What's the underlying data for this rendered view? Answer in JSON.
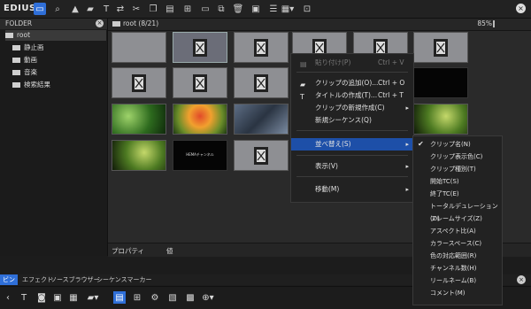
{
  "app": {
    "brand": "EDIUS"
  },
  "folder": {
    "header": "FOLDER",
    "items": [
      {
        "label": "root",
        "selected": true
      },
      {
        "label": "静止画"
      },
      {
        "label": "動画"
      },
      {
        "label": "音楽"
      },
      {
        "label": "検索結果"
      }
    ]
  },
  "bin": {
    "path": "root (8/21)",
    "zoom": "85%"
  },
  "properties": {
    "col1": "プロパティ",
    "col2": "値"
  },
  "clips": {
    "thumb_text": "HEMAチャンネル"
  },
  "tabs": {
    "items": [
      "ビン",
      "エフェクト",
      "ソースブラウザー",
      "シーケンスマーカー"
    ]
  },
  "context_menu": {
    "paste": {
      "label": "貼り付け(P)",
      "shortcut": "Ctrl + V"
    },
    "add_clip": {
      "label": "クリップの追加(O)...",
      "shortcut": "Ctrl + O"
    },
    "create_title": {
      "label": "タイトルの作成(T)...",
      "shortcut": "Ctrl + T"
    },
    "new_clip": {
      "label": "クリップの新規作成(C)"
    },
    "new_sequence": {
      "label": "新規シーケンス(Q)"
    },
    "sort": {
      "label": "並べ替え(S)"
    },
    "view": {
      "label": "表示(V)"
    },
    "move": {
      "label": "移動(M)"
    }
  },
  "sort_submenu": {
    "items": [
      {
        "label": "クリップ名(N)",
        "checked": true
      },
      {
        "label": "クリップ表示色(C)"
      },
      {
        "label": "クリップ種別(T)"
      },
      {
        "label": "開始TC(S)"
      },
      {
        "label": "終了TC(E)"
      },
      {
        "label": "トータルデュレーション(D)"
      },
      {
        "label": "フレームサイズ(Z)"
      },
      {
        "label": "アスペクト比(A)"
      },
      {
        "label": "カラースペース(C)"
      },
      {
        "label": "色の対応範囲(R)"
      },
      {
        "label": "チャンネル数(H)"
      },
      {
        "label": "リールネーム(B)"
      },
      {
        "label": "コメント(M)"
      }
    ]
  },
  "colors": {
    "accent": "#2f6fd8",
    "highlight": "#1d4fa8"
  }
}
